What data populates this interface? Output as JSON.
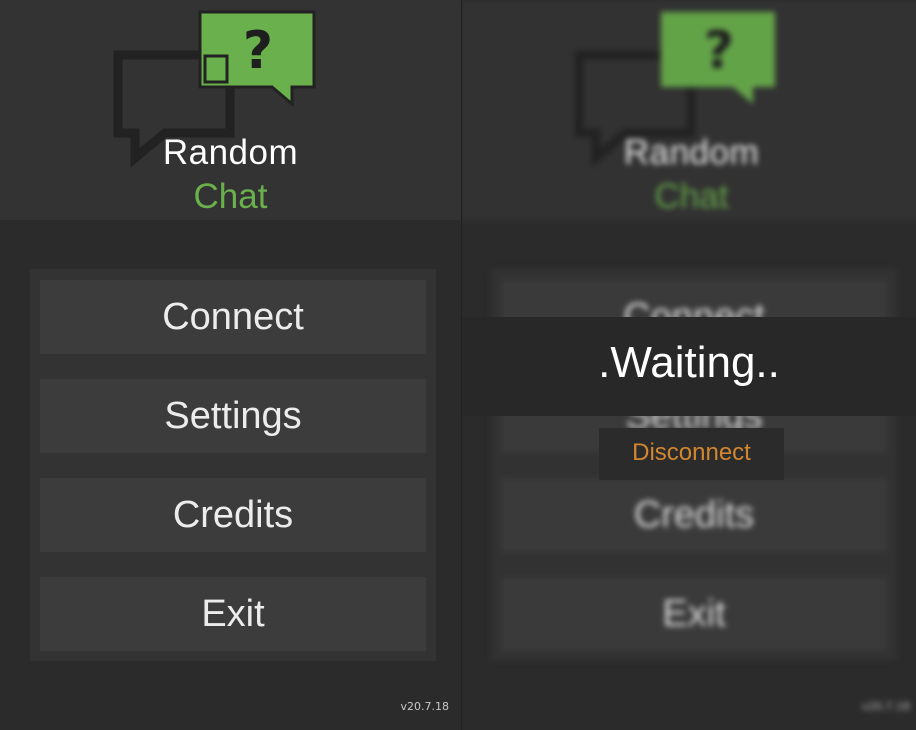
{
  "app": {
    "title_line1": "Random",
    "title_line2": "Chat",
    "version": "v20.7.18",
    "logo_icon": "chat-question-icon",
    "accent_color": "#6ab04c"
  },
  "menu": {
    "connect_label": "Connect",
    "settings_label": "Settings",
    "credits_label": "Credits",
    "exit_label": "Exit"
  },
  "waiting_dialog": {
    "status_text": ".Waiting..",
    "disconnect_label": "Disconnect",
    "disconnect_color": "#d2862f"
  }
}
